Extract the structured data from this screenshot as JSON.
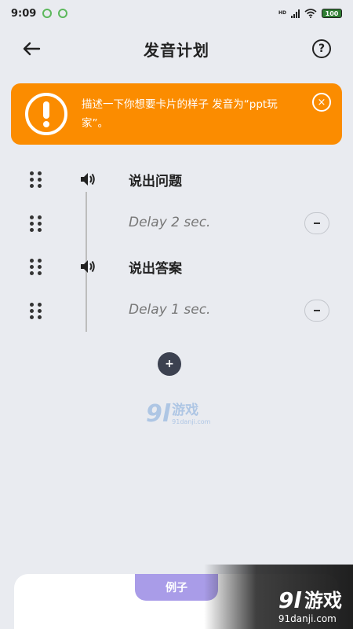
{
  "status": {
    "time": "9:09",
    "signal_label": "HD",
    "battery": "100"
  },
  "header": {
    "title": "发音计划",
    "back_icon": "arrow-left-icon",
    "help_label": "?"
  },
  "banner": {
    "text": "描述一下你想要卡片的样子 发音为“ppt玩家”。",
    "close_label": "×",
    "color": "#fb8c00"
  },
  "steps": [
    {
      "type": "speak",
      "label": "说出问题"
    },
    {
      "type": "delay",
      "label": "Delay 2 sec."
    },
    {
      "type": "speak",
      "label": "说出答案"
    },
    {
      "type": "delay",
      "label": "Delay 1 sec."
    }
  ],
  "add_label": "+",
  "bottom": {
    "tab_label": "例子",
    "tab_color": "#a99ce8"
  },
  "watermark": {
    "logo_number": "9l",
    "logo_text": "游戏",
    "url": "91danji.com"
  }
}
